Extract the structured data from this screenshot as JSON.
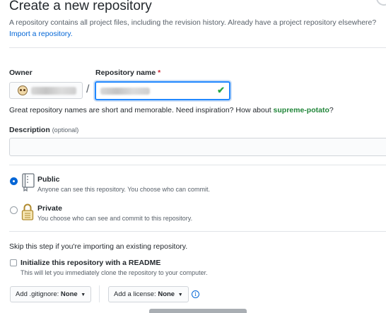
{
  "header": {
    "title": "Create a new repository",
    "intro_text": "A repository contains all project files, including the revision history. Already have a project repository elsewhere?",
    "import_link": "Import a repository."
  },
  "owner": {
    "label": "Owner",
    "selected_value": ""
  },
  "separator_slash": "/",
  "repository_name": {
    "label": "Repository name",
    "required_marker": "*",
    "value": "",
    "valid_icon": "check-icon"
  },
  "name_hint": {
    "text": "Great repository names are short and memorable. Need inspiration? How about",
    "suggestion": "supreme-potato",
    "end": "?"
  },
  "description": {
    "label": "Description",
    "optional_text": "(optional)",
    "value": ""
  },
  "visibility": {
    "options": [
      {
        "title": "Public",
        "description": "Anyone can see this repository. You choose who can commit.",
        "icon": "repo-book-icon",
        "selected": true
      },
      {
        "title": "Private",
        "description": "You choose who can see and commit to this repository.",
        "icon": "lock-icon",
        "selected": false
      }
    ]
  },
  "import_note": "Skip this step if you're importing an existing repository.",
  "initialize": {
    "title": "Initialize this repository with a README",
    "description": "This will let you immediately clone the repository to your computer.",
    "checked": false
  },
  "gitignore": {
    "label": "Add .gitignore:",
    "value": "None"
  },
  "license": {
    "label": "Add a license:",
    "value": "None"
  },
  "colors": {
    "accent": "#0366d6",
    "success": "#28a745",
    "suggestion": "#22863a",
    "required": "#cb2431"
  }
}
